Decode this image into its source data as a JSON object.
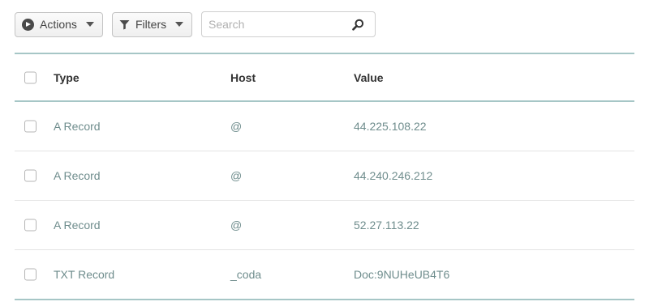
{
  "toolbar": {
    "actions_label": "Actions",
    "filters_label": "Filters",
    "search_placeholder": "Search"
  },
  "table": {
    "columns": [
      "Type",
      "Host",
      "Value"
    ],
    "rows": [
      {
        "type": "A Record",
        "host": "@",
        "value": "44.225.108.22"
      },
      {
        "type": "A Record",
        "host": "@",
        "value": "44.240.246.212"
      },
      {
        "type": "A Record",
        "host": "@",
        "value": "52.27.113.22"
      },
      {
        "type": "TXT Record",
        "host": "_coda",
        "value": "Doc:9NUHeUB4T6"
      }
    ]
  },
  "colors": {
    "accent_line": "#a6c6c6",
    "cell_text": "#6f8d8d",
    "header_text": "#333333"
  },
  "icons": [
    "play-circle-icon",
    "chevron-down-icon",
    "filter-icon",
    "search-icon"
  ]
}
